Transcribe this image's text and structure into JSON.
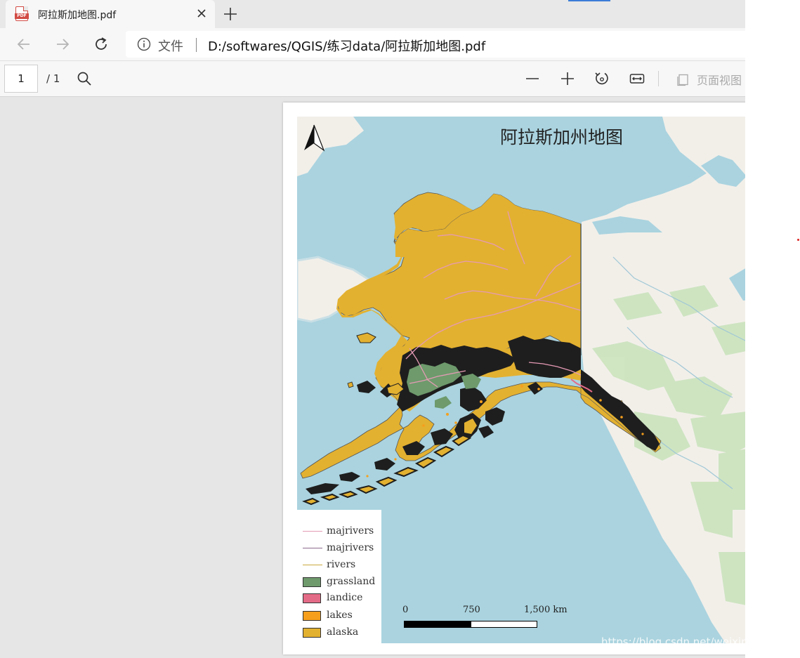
{
  "tab": {
    "title": "阿拉斯加地图.pdf",
    "icon": "pdf-icon"
  },
  "address_bar": {
    "security_label": "文件",
    "url": "D:/softwares/QGIS/练习data/阿拉斯加地图.pdf"
  },
  "pdf_toolbar": {
    "page_number": "1",
    "page_total": "/ 1",
    "page_view_label": "页面视图",
    "icons": [
      "search-icon",
      "zoom-out-icon",
      "zoom-in-icon",
      "rotate-icon",
      "fit-width-icon",
      "page-view-icon"
    ]
  },
  "map": {
    "title": "阿拉斯加州地图",
    "legend": [
      {
        "label": "majrivers",
        "kind": "line",
        "color": "#e59ab5"
      },
      {
        "label": "majrivers",
        "kind": "line",
        "color": "#8a6a8e"
      },
      {
        "label": "rivers",
        "kind": "line",
        "color": "#c8a93c"
      },
      {
        "label": "grassland",
        "kind": "fill",
        "color": "#6e9a6c"
      },
      {
        "label": "landice",
        "kind": "fill",
        "color": "#e46b87"
      },
      {
        "label": "lakes",
        "kind": "fill",
        "color": "#f59f1d"
      },
      {
        "label": "alaska",
        "kind": "fill",
        "color": "#e3b130"
      }
    ],
    "scale_labels": [
      "0",
      "750",
      "1,500 km"
    ],
    "colors": {
      "ocean": "#aad3df",
      "land_base": "#f2efe9",
      "alaska": "#e3b130",
      "forest": "#cde4bf"
    }
  },
  "watermark": "https://blog.csdn.net/weixin_"
}
